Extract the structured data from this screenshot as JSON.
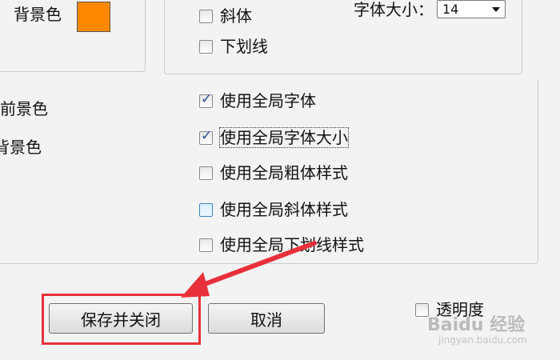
{
  "top_left": {
    "bg_color_label": "背景色",
    "swatch_color": "#fe8800"
  },
  "font_style": {
    "italic_label": "斜体",
    "underline_label": "下划线",
    "size_label": "字体大小：",
    "size_value": "14"
  },
  "side_labels": {
    "fg_color_label": "前景色",
    "bg_color_label": "背景色"
  },
  "options": [
    {
      "label": "使用全局字体",
      "checked": true
    },
    {
      "label": "使用全局字体大小",
      "checked": true
    },
    {
      "label": "使用全局粗体样式",
      "checked": false
    },
    {
      "label": "使用全局斜体样式",
      "checked": false
    },
    {
      "label": "使用全局下划线样式",
      "checked": false
    }
  ],
  "buttons": {
    "save_close": "保存并关闭",
    "cancel": "取消"
  },
  "transparency": {
    "label": "透明度",
    "checked": false
  },
  "watermark": {
    "brand": "Baidu 经验",
    "url": "jingyan.baidu.com"
  },
  "annotation": {
    "color": "#e8303a"
  }
}
